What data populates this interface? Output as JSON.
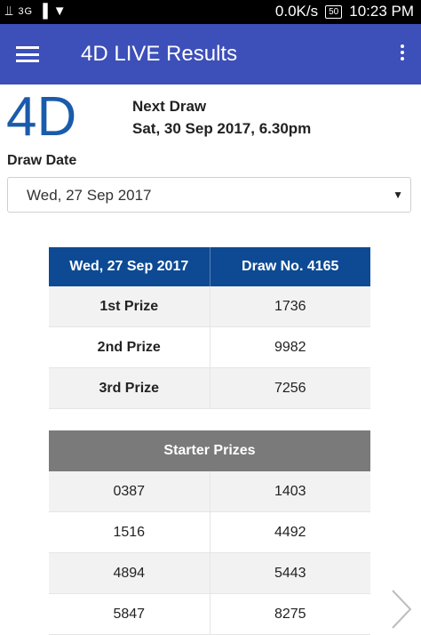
{
  "status_bar": {
    "left_text": "3G",
    "net_speed": "0.0K/s",
    "battery": "50",
    "time": "10:23 PM"
  },
  "app_bar": {
    "title": "4D LIVE Results",
    "color": "#3d4fb8"
  },
  "logo": {
    "text": "4D",
    "color": "#1a5bab"
  },
  "next_draw": {
    "label": "Next Draw",
    "value": "Sat, 30 Sep 2017, 6.30pm"
  },
  "draw_date": {
    "label": "Draw Date",
    "selected": "Wed, 27 Sep 2017"
  },
  "results": {
    "header_date": "Wed, 27 Sep 2017",
    "header_draw": "Draw No. 4165",
    "prizes": [
      {
        "name": "1st Prize",
        "number": "1736"
      },
      {
        "name": "2nd Prize",
        "number": "9982"
      },
      {
        "name": "3rd Prize",
        "number": "7256"
      }
    ],
    "starter_title": "Starter Prizes",
    "starter": [
      [
        "0387",
        "1403"
      ],
      [
        "1516",
        "4492"
      ],
      [
        "4894",
        "5443"
      ],
      [
        "5847",
        "8275"
      ]
    ]
  }
}
